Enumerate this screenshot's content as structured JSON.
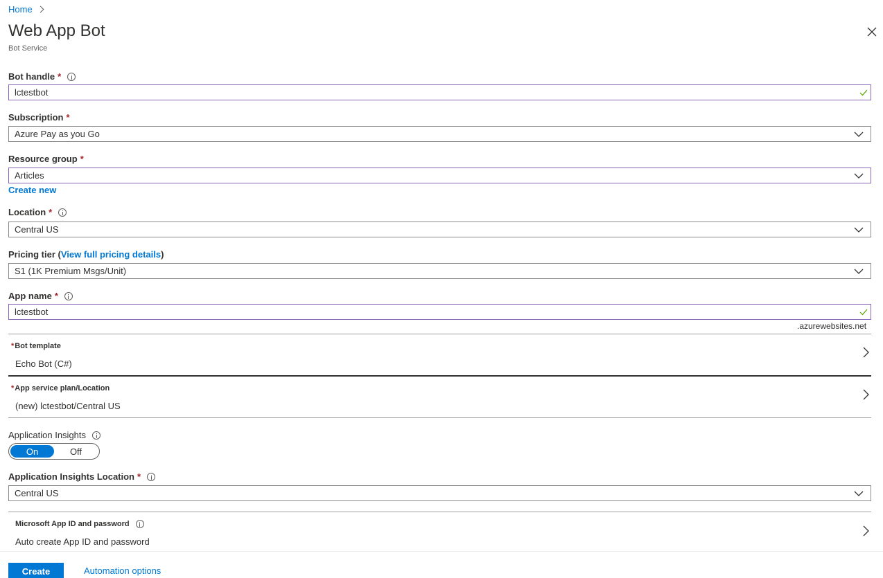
{
  "breadcrumb": {
    "home": "Home"
  },
  "header": {
    "title": "Web App Bot",
    "subtitle": "Bot Service"
  },
  "form": {
    "bot_handle": {
      "label": "Bot handle",
      "required": "*",
      "value": "lctestbot"
    },
    "subscription": {
      "label": "Subscription",
      "required": "*",
      "value": "Azure Pay as you Go"
    },
    "resource_group": {
      "label": "Resource group",
      "required": "*",
      "value": "Articles",
      "create_new": "Create new"
    },
    "location": {
      "label": "Location",
      "required": "*",
      "value": "Central US"
    },
    "pricing_tier": {
      "label_prefix": "Pricing tier (",
      "link": "View full pricing details",
      "label_suffix": ")",
      "value": "S1 (1K Premium Msgs/Unit)"
    },
    "app_name": {
      "label": "App name",
      "required": "*",
      "value": "lctestbot",
      "suffix": ".azurewebsites.net"
    },
    "bot_template": {
      "star": "*",
      "label": "Bot template",
      "value": "Echo Bot (C#)"
    },
    "app_service_plan": {
      "star": "*",
      "label": "App service plan/Location",
      "value": "(new) lctestbot/Central US"
    },
    "app_insights": {
      "label": "Application Insights",
      "on": "On",
      "off": "Off"
    },
    "app_insights_location": {
      "label": "Application Insights Location",
      "required": "*",
      "value": "Central US"
    },
    "ms_app_id": {
      "label": "Microsoft App ID and password",
      "value": "Auto create App ID and password"
    }
  },
  "footer": {
    "create": "Create",
    "automation": "Automation options"
  },
  "colors": {
    "accent": "#0078d4",
    "focus_border": "#8764b8",
    "required": "#a4262c",
    "valid": "#57a300"
  },
  "icons": {
    "close": "close-icon",
    "chevron_down": "chevron-down-icon",
    "chevron_right": "chevron-right-icon",
    "info": "info-icon",
    "check": "check-icon"
  }
}
